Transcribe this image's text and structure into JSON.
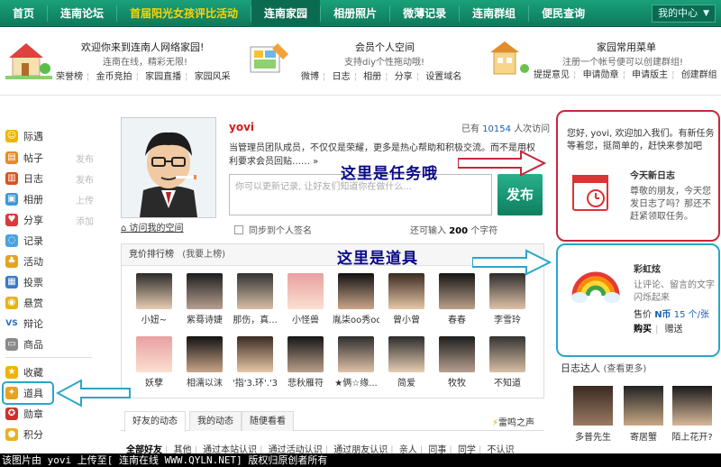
{
  "nav": {
    "items": [
      "首页",
      "连南论坛",
      "首届阳光女孩评比活动",
      "连南家园",
      "相册照片",
      "微薄记录",
      "连南群组",
      "便民查询"
    ],
    "my_center": "我的中心"
  },
  "welcome": {
    "title": "欢迎你来到连南人网络家园!",
    "subtitle": "连南在线，精彩无限!",
    "links": [
      "荣誉榜",
      "金币竞拍",
      "家园直播",
      "家园风采"
    ]
  },
  "member": {
    "title": "会员个人空间",
    "subtitle": "支持diy个性拖动哦!",
    "links": [
      "微博",
      "日志",
      "相册",
      "分享",
      "设置域名"
    ]
  },
  "menu": {
    "title": "家园常用菜单",
    "subtitle": "注册一个帐号便可以创建群组!",
    "links": [
      "提提意见",
      "申请勋章",
      "申请版主",
      "创建群组"
    ]
  },
  "sidebar": {
    "items": [
      {
        "label": "际遇",
        "action": ""
      },
      {
        "label": "帖子",
        "action": "发布"
      },
      {
        "label": "日志",
        "action": "发布"
      },
      {
        "label": "相册",
        "action": "上传"
      },
      {
        "label": "分享",
        "action": "添加"
      },
      {
        "label": "记录",
        "action": ""
      },
      {
        "label": "活动",
        "action": ""
      },
      {
        "label": "投票",
        "action": ""
      },
      {
        "label": "悬赏",
        "action": ""
      },
      {
        "label": "辩论",
        "action": ""
      },
      {
        "label": "商品",
        "action": ""
      },
      {
        "label": "收藏",
        "action": ""
      },
      {
        "label": "道具",
        "action": ""
      },
      {
        "label": "勋章",
        "action": ""
      },
      {
        "label": "积分",
        "action": ""
      }
    ]
  },
  "profile": {
    "username": "yovi",
    "visits_prefix": "已有",
    "visits": "10154",
    "visits_suffix": "人次访问",
    "intro": "当管理员团队成员，不仅仅是荣耀，更多是热心帮助和积极交流。而不是用权利要求会员回贴……  »",
    "status_placeholder": "你可以更新记录, 让好友们知道你在做什么...",
    "post_label": "发布",
    "visit_space": "访问我的空间",
    "sync_label": "同步到个人签名",
    "remain_prefix": "还可输入",
    "remain_count": "200",
    "remain_suffix": "个字符"
  },
  "ranking": {
    "title": "竞价排行榜",
    "join": "(我要上榜)",
    "row1": [
      "小妞~",
      "紫蓦诗婕",
      "那伤，真...",
      "小怪兽",
      "胤柒oo秀oo",
      "曾小曾",
      "春春",
      "李雪玲"
    ],
    "row2": [
      "妖孽",
      "相濡以沫",
      "'指'3.环'.'3",
      "悲秋雁符",
      "★俩☆缘...",
      "简爱",
      "牧牧",
      "不知道"
    ]
  },
  "feed": {
    "tabs": [
      "好友的动态",
      "我的动态",
      "随便看看"
    ],
    "thunder": "雷鸣之声",
    "filters": [
      "全部好友",
      "其他",
      "通过本站认识",
      "通过活动认识",
      "通过朋友认识",
      "亲人",
      "同事",
      "同学",
      "不认识"
    ]
  },
  "task": {
    "text": "您好, yovi, 欢迎加入我们。有新任务等着您，挺简单的，赶快来参加吧",
    "title": "今天新日志",
    "desc": "尊敬的朋友，今天您发日志了吗？那还不赶紧领取任务。"
  },
  "tool": {
    "name": "彩虹炫",
    "desc": "让评论、留言的文字闪烁起来",
    "price_prefix": "售价",
    "price_value": "N币",
    "price_amount": "15 个/张",
    "buy": "购买",
    "gift": "赠送"
  },
  "diary": {
    "title": "日志达人",
    "more": "(查看更多)",
    "people": [
      "多普先生",
      "寄居蟹",
      "陌上花开?"
    ]
  },
  "annotations": {
    "task": "这里是任务哦",
    "tool": "这里是道具"
  },
  "caption": "该图片由 yovi 上传至[ 连南在线 WWW.QYLN.NET] 版权归原创者所有",
  "colors": {
    "nav": "#0d7a5c",
    "accent": "#c6283a",
    "tool": "#2aa6c9"
  }
}
